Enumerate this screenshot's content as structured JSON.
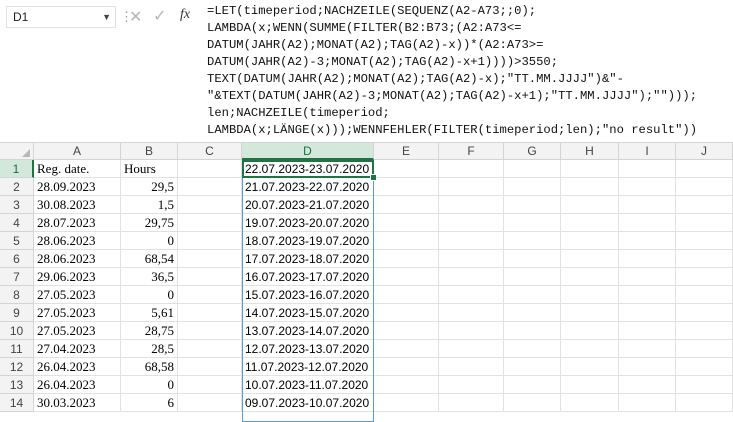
{
  "name_box": {
    "value": "D1"
  },
  "toolbar": {
    "fx_label": "fx",
    "cancel_icon": "cancel-icon",
    "enter_icon": "check-icon"
  },
  "formula_lines": [
    "=LET(timeperiod;NACHZEILE(SEQUENZ(A2-A73;;0);",
    "LAMBDA(x;WENN(SUMME(FILTER(B2:B73;(A2:A73<=",
    "DATUM(JAHR(A2);MONAT(A2);TAG(A2)-x))*(A2:A73>=",
    "DATUM(JAHR(A2)-3;MONAT(A2);TAG(A2)-x+1))))>3550;",
    "TEXT(DATUM(JAHR(A2);MONAT(A2);TAG(A2)-x);\"TT.MM.JJJJ\")&\"-",
    "\"&TEXT(DATUM(JAHR(A2)-3;MONAT(A2);TAG(A2)-x+1);\"TT.MM.JJJJ\");\"\")));",
    "len;NACHZEILE(timeperiod;",
    "LAMBDA(x;LÄNGE(x)));WENNFEHLER(FILTER(timeperiod;len);\"no result\"))"
  ],
  "columns": [
    "A",
    "B",
    "C",
    "D",
    "E",
    "F",
    "G",
    "H",
    "I",
    "J"
  ],
  "active_column": "D",
  "active_row": "1",
  "rows": [
    {
      "n": "1",
      "a": "Reg. date.",
      "b": "Hours",
      "d": "22.07.2023-23.07.2020"
    },
    {
      "n": "2",
      "a": "28.09.2023",
      "b": "29,5",
      "d": "21.07.2023-22.07.2020"
    },
    {
      "n": "3",
      "a": "30.08.2023",
      "b": "1,5",
      "d": "20.07.2023-21.07.2020"
    },
    {
      "n": "4",
      "a": "28.07.2023",
      "b": "29,75",
      "d": "19.07.2023-20.07.2020"
    },
    {
      "n": "5",
      "a": "28.06.2023",
      "b": "0",
      "d": "18.07.2023-19.07.2020"
    },
    {
      "n": "6",
      "a": "28.06.2023",
      "b": "68,54",
      "d": "17.07.2023-18.07.2020"
    },
    {
      "n": "7",
      "a": "29.06.2023",
      "b": "36,5",
      "d": "16.07.2023-17.07.2020"
    },
    {
      "n": "8",
      "a": "27.05.2023",
      "b": "0",
      "d": "15.07.2023-16.07.2020"
    },
    {
      "n": "9",
      "a": "27.05.2023",
      "b": "5,61",
      "d": "14.07.2023-15.07.2020"
    },
    {
      "n": "10",
      "a": "27.05.2023",
      "b": "28,75",
      "d": "13.07.2023-14.07.2020"
    },
    {
      "n": "11",
      "a": "27.04.2023",
      "b": "28,5",
      "d": "12.07.2023-13.07.2020"
    },
    {
      "n": "12",
      "a": "26.04.2023",
      "b": "68,58",
      "d": "11.07.2023-12.07.2020"
    },
    {
      "n": "13",
      "a": "26.04.2023",
      "b": "0",
      "d": "10.07.2023-11.07.2020"
    },
    {
      "n": "14",
      "a": "30.03.2023",
      "b": "6",
      "d": "09.07.2023-10.07.2020"
    }
  ],
  "colors": {
    "accent": "#217346",
    "spill": "#5b9bd5",
    "header_bg": "#f3f3f3",
    "header_active_bg": "#d2e8da"
  }
}
